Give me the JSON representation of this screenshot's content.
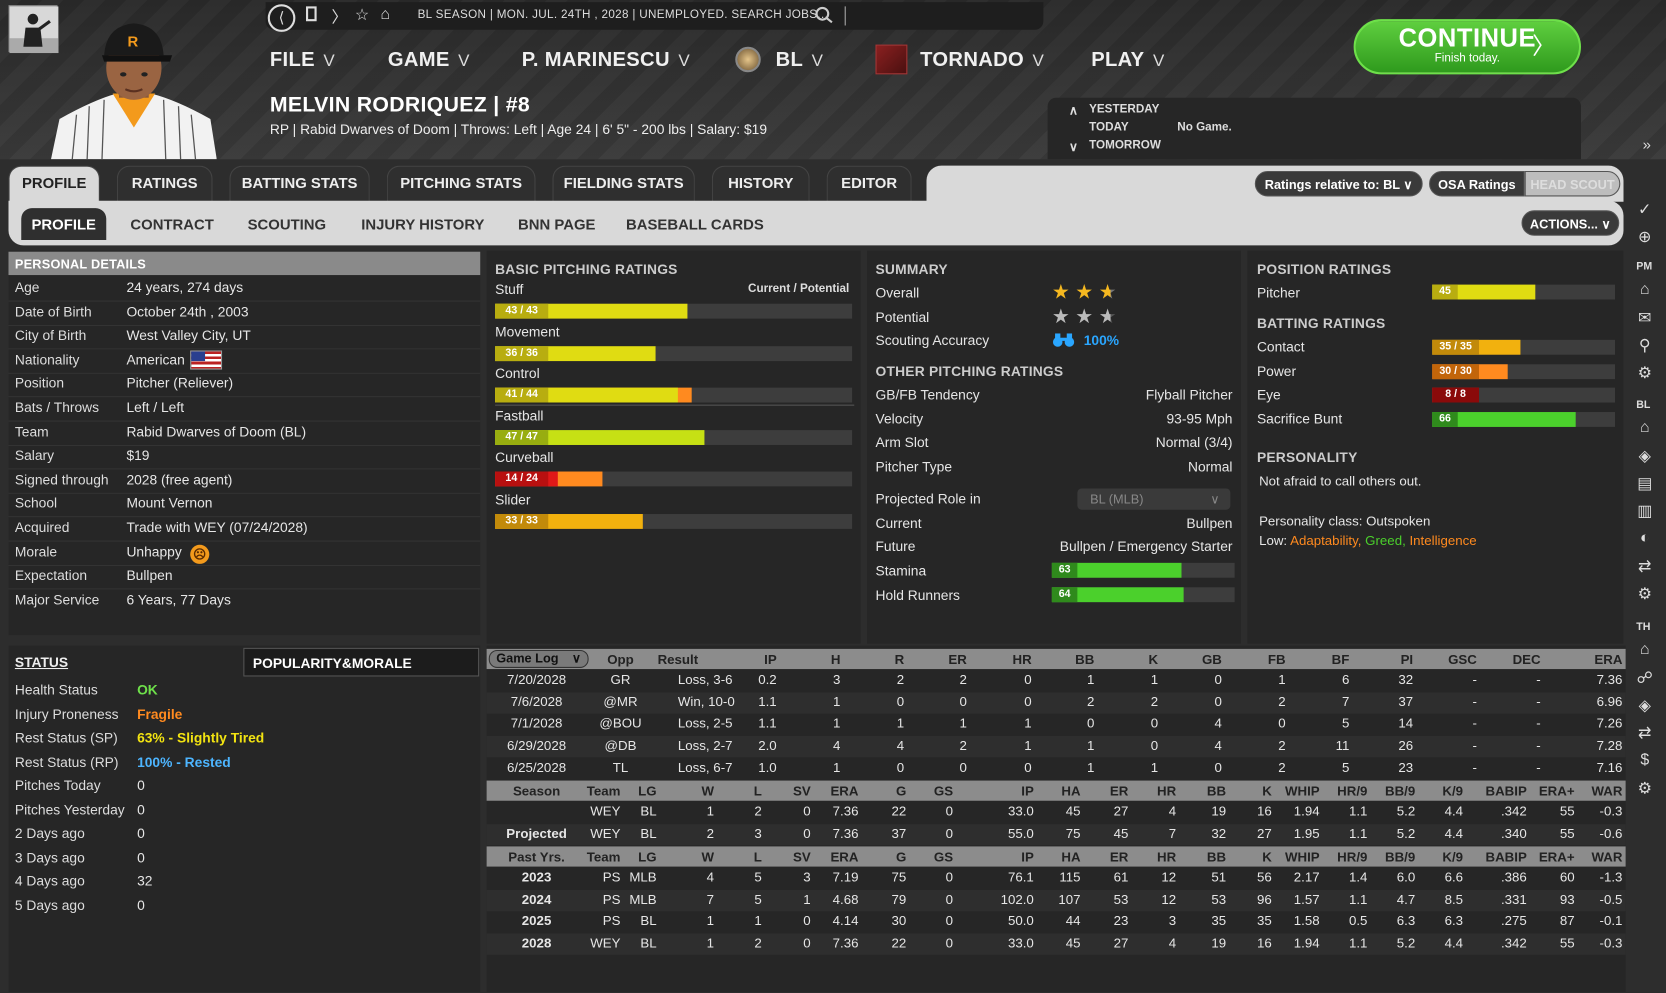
{
  "topbar": {
    "status": "BL SEASON  |  MON. JUL. 24TH , 2028  |  UNEMPLOYED. SEARCH JOBS...",
    "nav": [
      {
        "label": "FILE"
      },
      {
        "label": "GAME"
      },
      {
        "label": "P. MARINESCU"
      },
      {
        "label": "BL"
      },
      {
        "label": "TORNADO"
      },
      {
        "label": "PLAY"
      }
    ]
  },
  "continue": {
    "label": "CONTINUE",
    "sub": "Finish today."
  },
  "schedule": {
    "yesterday": "YESTERDAY",
    "today": "TODAY",
    "tomorrow": "TOMORROW",
    "game": "No Game."
  },
  "player": {
    "name": "MELVIN RODRIQUEZ  |  #8",
    "info": "RP | Rabid Dwarves of Doom  |  Throws: Left  |  Age 24  |  6' 5\" - 200 lbs  |  Salary: $19",
    "cap_letter": "R"
  },
  "tabs": [
    "PROFILE",
    "RATINGS",
    "BATTING STATS",
    "PITCHING STATS",
    "FIELDING STATS",
    "HISTORY",
    "EDITOR"
  ],
  "subtabs": [
    "PROFILE",
    "CONTRACT",
    "SCOUTING",
    "INJURY HISTORY",
    "BNN PAGE",
    "BASEBALL CARDS"
  ],
  "controls": {
    "ratings_relative": "Ratings relative to: BL",
    "osa": "OSA Ratings",
    "head_scout": "HEAD SCOUT",
    "actions": "ACTIONS..."
  },
  "personal": {
    "title": "PERSONAL DETAILS",
    "rows": [
      {
        "k": "Age",
        "v": "24 years, 274 days"
      },
      {
        "k": "Date of Birth",
        "v": "October 24th , 2003"
      },
      {
        "k": "City of Birth",
        "v": "West Valley City, UT"
      },
      {
        "k": "Nationality",
        "v": "American"
      },
      {
        "k": "Position",
        "v": "Pitcher (Reliever)"
      },
      {
        "k": "Bats / Throws",
        "v": "Left / Left"
      },
      {
        "k": "Team",
        "v": "Rabid Dwarves of Doom (BL)"
      },
      {
        "k": "Salary",
        "v": "$19"
      },
      {
        "k": "Signed through",
        "v": "2028 (free agent)"
      },
      {
        "k": "School",
        "v": "Mount Vernon"
      },
      {
        "k": "Acquired",
        "v": "Trade with WEY (07/24/2028)"
      },
      {
        "k": "Morale",
        "v": "Unhappy"
      },
      {
        "k": "Expectation",
        "v": "Bullpen"
      },
      {
        "k": "Major Service",
        "v": "6 Years, 77 Days"
      }
    ]
  },
  "status": {
    "tab": "STATUS",
    "tab2": "POPULARITY&MORALE",
    "rows": [
      {
        "k": "Health Status",
        "v": "OK",
        "color": "#6ee04a"
      },
      {
        "k": "Injury Proneness",
        "v": "Fragile",
        "color": "#ff8a1f"
      },
      {
        "k": "Rest Status (SP)",
        "v": "63% - Slightly Tired",
        "color": "#f2e311"
      },
      {
        "k": "Rest Status (RP)",
        "v": "100% - Rested",
        "color": "#4db5ff"
      },
      {
        "k": "Pitches Today",
        "v": "0",
        "color": "#e6e6e6"
      },
      {
        "k": "Pitches Yesterday",
        "v": "0",
        "color": "#e6e6e6"
      },
      {
        "k": "2 Days ago",
        "v": "0",
        "color": "#e6e6e6"
      },
      {
        "k": "3 Days ago",
        "v": "0",
        "color": "#e6e6e6"
      },
      {
        "k": "4 Days ago",
        "v": "32",
        "color": "#e6e6e6"
      },
      {
        "k": "5 Days ago",
        "v": "0",
        "color": "#e6e6e6"
      }
    ]
  },
  "pitching": {
    "title": "BASIC PITCHING RATINGS",
    "legend": "Current / Potential",
    "ratings": [
      {
        "name": "Stuff",
        "label": "43 / 43",
        "cur": 43,
        "pot": 43,
        "max": 80,
        "color": "#e0dc12",
        "lcolor": "#b8ad10"
      },
      {
        "name": "Movement",
        "label": "36 / 36",
        "cur": 36,
        "pot": 36,
        "max": 80,
        "color": "#e0dc12",
        "lcolor": "#b8ad10"
      },
      {
        "name": "Control",
        "label": "41 / 44",
        "cur": 41,
        "pot": 44,
        "max": 80,
        "color": "#e0dc12",
        "lcolor": "#b8ad10"
      },
      {
        "name": "Fastball",
        "label": "47 / 47",
        "cur": 47,
        "pot": 47,
        "max": 80,
        "color": "#c6e014",
        "lcolor": "#98ad10"
      },
      {
        "name": "Curveball",
        "label": "14 / 24",
        "cur": 14,
        "pot": 24,
        "max": 80,
        "color": "#e01818",
        "lcolor": "#b81010"
      },
      {
        "name": "Slider",
        "label": "33 / 33",
        "cur": 33,
        "pot": 33,
        "max": 80,
        "color": "#f2b10e",
        "lcolor": "#c28a0a"
      }
    ]
  },
  "summary": {
    "title": "SUMMARY",
    "overall_label": "Overall",
    "overall_stars": 2.5,
    "potential_label": "Potential",
    "potential_stars": 2.5,
    "scouting_label": "Scouting Accuracy",
    "scouting": "100%"
  },
  "other": {
    "title": "OTHER PITCHING RATINGS",
    "rows": [
      {
        "k": "GB/FB Tendency",
        "v": "Flyball Pitcher"
      },
      {
        "k": "Velocity",
        "v": "93-95 Mph"
      },
      {
        "k": "Arm Slot",
        "v": "Normal (3/4)"
      },
      {
        "k": "Pitcher Type",
        "v": "Normal"
      }
    ],
    "role_label": "Projected Role in",
    "role_select": "BL (MLB)",
    "current_label": "Current",
    "current": "Bullpen",
    "future_label": "Future",
    "future": "Bullpen / Emergency Starter",
    "stamina_label": "Stamina",
    "stamina": 63,
    "hold_label": "Hold Runners",
    "hold": 64
  },
  "position": {
    "title": "POSITION RATINGS",
    "pitcher_label": "Pitcher",
    "pitcher": 45
  },
  "batting": {
    "title": "BATTING RATINGS",
    "rows": [
      {
        "name": "Contact",
        "label": "35 / 35",
        "cur": 35,
        "max": 80,
        "color": "#f2b10e",
        "lcolor": "#c28a0a"
      },
      {
        "name": "Power",
        "label": "30 / 30",
        "cur": 30,
        "max": 80,
        "color": "#ff8a1f",
        "lcolor": "#c2650a"
      },
      {
        "name": "Eye",
        "label": "8 / 8",
        "cur": 8,
        "max": 80,
        "color": "#e01818",
        "lcolor": "#8a0a0a"
      },
      {
        "name": "Sacrifice Bunt",
        "label": "66",
        "cur": 66,
        "max": 80,
        "color": "#4bd02c",
        "lcolor": "#2f8a1c"
      }
    ]
  },
  "personality": {
    "title": "PERSONALITY",
    "desc": "Not afraid to call others out.",
    "class": "Personality class: Outspoken",
    "low_label": "Low:",
    "low1": "Adaptability,",
    "low2": "Greed,",
    "low3": "Intelligence"
  },
  "gamelog": {
    "select": "Game Log",
    "headers": [
      "Opp",
      "Result",
      "IP",
      "H",
      "R",
      "ER",
      "HR",
      "BB",
      "K",
      "GB",
      "FB",
      "BF",
      "PI",
      "GSC",
      "DEC",
      "ERA"
    ],
    "rows": [
      [
        "7/20/2028",
        "GR",
        "Loss, 3-6",
        "0.2",
        "3",
        "2",
        "2",
        "0",
        "1",
        "1",
        "0",
        "1",
        "6",
        "32",
        "-",
        "-",
        "7.36"
      ],
      [
        "7/6/2028",
        "@MR",
        "Win, 10-0",
        "1.1",
        "1",
        "0",
        "0",
        "0",
        "2",
        "2",
        "0",
        "2",
        "7",
        "37",
        "-",
        "-",
        "6.96"
      ],
      [
        "7/1/2028",
        "@BOU",
        "Loss, 2-5",
        "1.1",
        "1",
        "1",
        "1",
        "1",
        "0",
        "0",
        "4",
        "0",
        "5",
        "14",
        "-",
        "-",
        "7.26"
      ],
      [
        "6/29/2028",
        "@DB",
        "Loss, 2-7",
        "2.0",
        "4",
        "4",
        "2",
        "1",
        "1",
        "0",
        "4",
        "2",
        "11",
        "26",
        "-",
        "-",
        "7.28"
      ],
      [
        "6/25/2028",
        "TL",
        "Loss, 6-7",
        "1.0",
        "1",
        "0",
        "0",
        "0",
        "1",
        "1",
        "0",
        "2",
        "5",
        "23",
        "-",
        "-",
        "7.16"
      ]
    ]
  },
  "season": {
    "headers": [
      "Season",
      "Team",
      "LG",
      "W",
      "L",
      "SV",
      "ERA",
      "G",
      "GS",
      "IP",
      "HA",
      "ER",
      "HR",
      "BB",
      "K",
      "WHIP",
      "HR/9",
      "BB/9",
      "K/9",
      "BABIP",
      "ERA+",
      "WAR"
    ],
    "rows": [
      [
        "",
        "WEY",
        "BL",
        "1",
        "2",
        "0",
        "7.36",
        "22",
        "0",
        "33.0",
        "45",
        "27",
        "4",
        "19",
        "16",
        "1.94",
        "1.1",
        "5.2",
        "4.4",
        ".342",
        "55",
        "-0.3"
      ],
      [
        "Projected",
        "WEY",
        "BL",
        "2",
        "3",
        "0",
        "7.36",
        "37",
        "0",
        "55.0",
        "75",
        "45",
        "7",
        "32",
        "27",
        "1.95",
        "1.1",
        "5.2",
        "4.4",
        ".340",
        "55",
        "-0.6"
      ]
    ]
  },
  "past": {
    "headers": [
      "Past Yrs.",
      "Team",
      "LG",
      "W",
      "L",
      "SV",
      "ERA",
      "G",
      "GS",
      "IP",
      "HA",
      "ER",
      "HR",
      "BB",
      "K",
      "WHIP",
      "HR/9",
      "BB/9",
      "K/9",
      "BABIP",
      "ERA+",
      "WAR"
    ],
    "rows": [
      [
        "2023",
        "PS",
        "MLB",
        "4",
        "5",
        "3",
        "7.19",
        "75",
        "0",
        "76.1",
        "115",
        "61",
        "12",
        "51",
        "56",
        "2.17",
        "1.4",
        "6.0",
        "6.6",
        ".386",
        "60",
        "-1.3"
      ],
      [
        "2024",
        "PS",
        "MLB",
        "7",
        "5",
        "1",
        "4.68",
        "79",
        "0",
        "102.0",
        "107",
        "53",
        "12",
        "53",
        "96",
        "1.57",
        "1.1",
        "4.7",
        "8.5",
        ".331",
        "93",
        "-0.5"
      ],
      [
        "2025",
        "PS",
        "BL",
        "1",
        "1",
        "0",
        "4.14",
        "30",
        "0",
        "50.0",
        "44",
        "23",
        "3",
        "35",
        "35",
        "1.58",
        "0.5",
        "6.3",
        "6.3",
        ".275",
        "87",
        "-0.1"
      ],
      [
        "2028",
        "WEY",
        "BL",
        "1",
        "2",
        "0",
        "7.36",
        "22",
        "0",
        "33.0",
        "45",
        "27",
        "4",
        "19",
        "16",
        "1.94",
        "1.1",
        "5.2",
        "4.4",
        ".342",
        "55",
        "-0.3"
      ]
    ]
  },
  "rightbar": {
    "pm": "PM",
    "bl": "BL",
    "th": "TH"
  }
}
